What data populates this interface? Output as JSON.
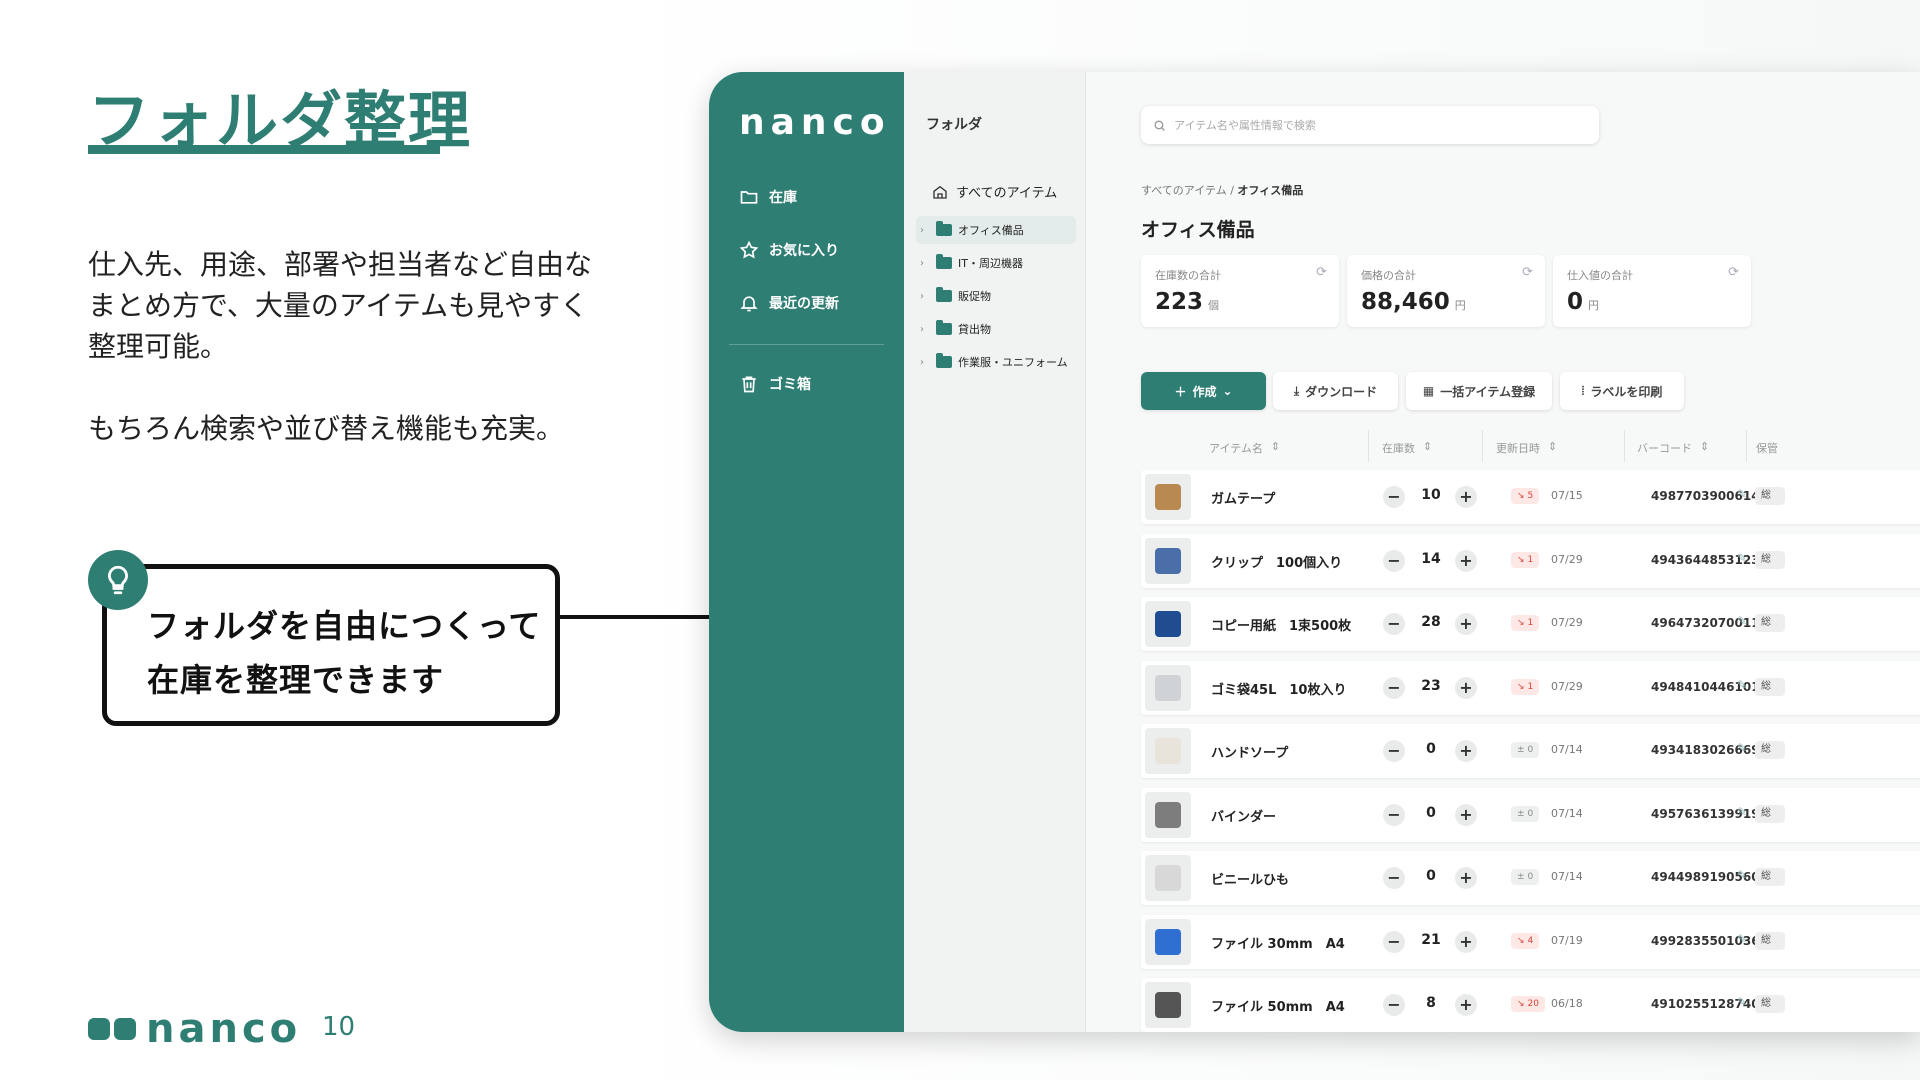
{
  "slide": {
    "title": "フォルダ整理",
    "description_lines": [
      "仕入先、用途、部署や担当者など自由な",
      "まとめ方で、大量のアイテムも見やすく",
      "整理可能。"
    ],
    "description2": "もちろん検索や並び替え機能も充実。",
    "callout_lines": [
      "フォルダを自由につくって",
      "在庫を整理できます"
    ],
    "footer_logo": "nanco",
    "page_number": "10",
    "brand_color": "#2f7e73"
  },
  "app": {
    "brand": "nanco",
    "nav": [
      {
        "label": "在庫",
        "icon": "folder-open-icon"
      },
      {
        "label": "お気に入り",
        "icon": "star-icon"
      },
      {
        "label": "最近の更新",
        "icon": "bell-icon"
      },
      {
        "label": "ゴミ箱",
        "icon": "trash-icon"
      }
    ],
    "folders_title": "フォルダ",
    "all_items": "すべてのアイテム",
    "folders": [
      "オフィス備品",
      "IT・周辺機器",
      "販促物",
      "貸出物",
      "作業服・ユニフォーム"
    ],
    "search_placeholder": "アイテム名や属性情報で検索",
    "breadcrumb_root": "すべてのアイテム",
    "breadcrumb_sep": "/",
    "breadcrumb_current": "オフィス備品",
    "page_title": "オフィス備品",
    "stats": [
      {
        "label": "在庫数の合計",
        "value": "223",
        "unit": "個"
      },
      {
        "label": "価格の合計",
        "value": "88,460",
        "unit": "円"
      },
      {
        "label": "仕入値の合計",
        "value": "0",
        "unit": "円"
      }
    ],
    "buttons": {
      "create": "作成",
      "download": "ダウンロード",
      "bulk": "一括アイテム登録",
      "label": "ラベルを印刷"
    },
    "columns": [
      "アイテム名",
      "在庫数",
      "更新日時",
      "バーコード",
      "保管"
    ],
    "rows": [
      {
        "name": "ガムテープ",
        "qty": "10",
        "change": "5",
        "dir": "down",
        "date": "07/15",
        "barcode": "4987703900614",
        "loc": "総"
      },
      {
        "name": "クリップ　100個入り",
        "qty": "14",
        "change": "1",
        "dir": "down",
        "date": "07/29",
        "barcode": "4943644853123",
        "loc": "総"
      },
      {
        "name": "コピー用紙　1束500枚",
        "qty": "28",
        "change": "1",
        "dir": "down",
        "date": "07/29",
        "barcode": "4964732070011",
        "loc": "総"
      },
      {
        "name": "ゴミ袋45L　10枚入り",
        "qty": "23",
        "change": "1",
        "dir": "down",
        "date": "07/29",
        "barcode": "4948410446101",
        "loc": "総"
      },
      {
        "name": "ハンドソープ",
        "qty": "0",
        "change": "0",
        "dir": "zero",
        "date": "07/14",
        "barcode": "4934183026669",
        "loc": "総"
      },
      {
        "name": "バインダー",
        "qty": "0",
        "change": "0",
        "dir": "zero",
        "date": "07/14",
        "barcode": "4957636139919",
        "loc": "総"
      },
      {
        "name": "ビニールひも",
        "qty": "0",
        "change": "0",
        "dir": "zero",
        "date": "07/14",
        "barcode": "4944989190560",
        "loc": "総"
      },
      {
        "name": "ファイル 30mm　A4",
        "qty": "21",
        "change": "4",
        "dir": "down",
        "date": "07/19",
        "barcode": "4992835501036",
        "loc": "総"
      },
      {
        "name": "ファイル 50mm　A4",
        "qty": "8",
        "change": "20",
        "dir": "down",
        "date": "06/18",
        "barcode": "4910255128740",
        "loc": "総"
      }
    ]
  }
}
